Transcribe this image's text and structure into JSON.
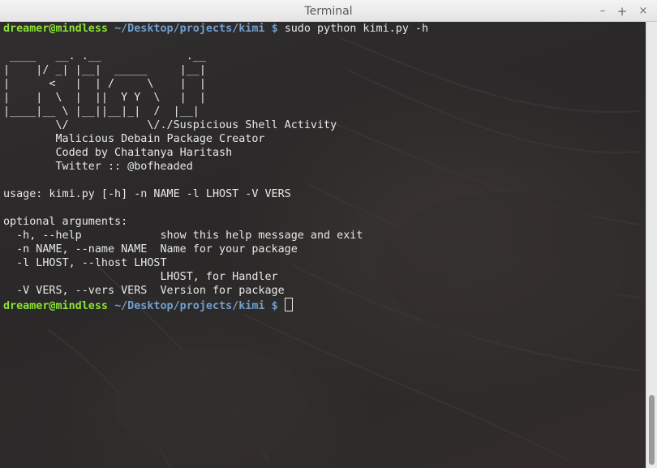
{
  "window": {
    "title": "Terminal",
    "minimize_glyph": "–",
    "maximize_glyph": "+",
    "close_glyph": "×"
  },
  "prompt": {
    "user_host": "dreamer@mindless",
    "path": "~/Desktop/projects/kimi",
    "symbol": "$"
  },
  "command": "sudo python kimi.py -h",
  "banner": [
    " ____   __. .__             .__ ",
    "|    |/ _| |__|  _____     |__|",
    "|      <   |  | /     \\    |  |",
    "|    |  \\  |  ||  Y Y  \\   |  |",
    "|____|__ \\ |__||__|_|  /  |__|",
    "        \\/            \\/"
  ],
  "banner_tagline": "./Suspicious Shell Activity",
  "info": [
    "        Malicious Debain Package Creator",
    "        Coded by Chaitanya Haritash",
    "        Twitter :: @bofheaded"
  ],
  "usage": "usage: kimi.py [-h] -n NAME -l LHOST -V VERS",
  "optional_header": "optional arguments:",
  "options": [
    "  -h, --help            show this help message and exit",
    "  -n NAME, --name NAME  Name for your package",
    "  -l LHOST, --lhost LHOST",
    "                        LHOST, for Handler",
    "  -V VERS, --vers VERS  Version for package"
  ],
  "colors": {
    "prompt_user": "#8ae234",
    "prompt_path": "#729fcf",
    "foreground": "#e8e8e8",
    "background": "#2a2828"
  }
}
